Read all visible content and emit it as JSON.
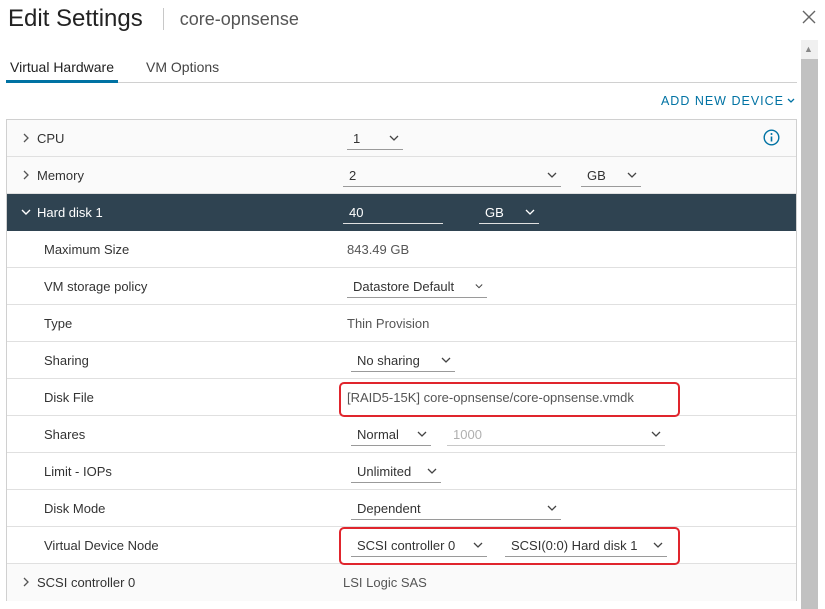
{
  "dialog": {
    "title": "Edit Settings",
    "vm_name": "core-opnsense"
  },
  "tabs": [
    {
      "label": "Virtual Hardware",
      "active": true
    },
    {
      "label": "VM Options",
      "active": false
    }
  ],
  "add_new_device_label": "ADD NEW DEVICE",
  "cpu": {
    "label": "CPU",
    "value": "1"
  },
  "memory": {
    "label": "Memory",
    "value": "2",
    "unit": "GB"
  },
  "hard_disk": {
    "label": "Hard disk 1",
    "size": "40",
    "unit": "GB",
    "rows": {
      "max_size": {
        "label": "Maximum Size",
        "value": "843.49 GB"
      },
      "storage_policy": {
        "label": "VM storage policy",
        "value": "Datastore Default"
      },
      "type": {
        "label": "Type",
        "value": "Thin Provision"
      },
      "sharing": {
        "label": "Sharing",
        "value": "No sharing"
      },
      "disk_file": {
        "label": "Disk File",
        "value": "[RAID5-15K] core-opnsense/core-opnsense.vmdk"
      },
      "shares": {
        "label": "Shares",
        "value": "Normal",
        "amount": "1000"
      },
      "limit_iops": {
        "label": "Limit - IOPs",
        "value": "Unlimited"
      },
      "disk_mode": {
        "label": "Disk Mode",
        "value": "Dependent"
      },
      "vdn": {
        "label": "Virtual Device Node",
        "controller": "SCSI controller 0",
        "node": "SCSI(0:0) Hard disk 1"
      }
    }
  },
  "scsi": {
    "label": "SCSI controller 0",
    "value": "LSI Logic SAS"
  },
  "colors": {
    "accent": "#0072a3",
    "expanded_bg": "#2f4351",
    "highlight": "#e0252d"
  }
}
